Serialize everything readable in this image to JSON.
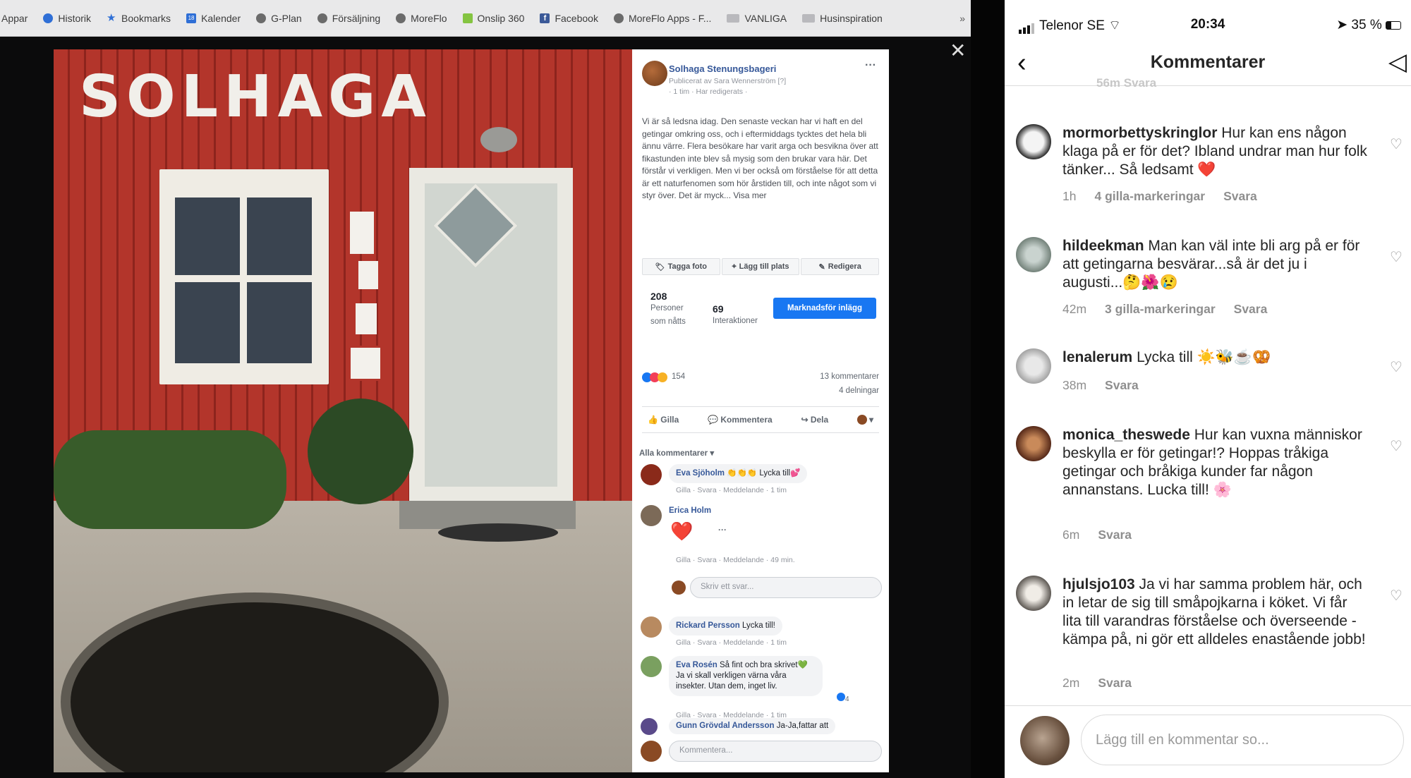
{
  "browser": {
    "bookmarks": [
      {
        "label": "Appar",
        "icon": "apps-icon"
      },
      {
        "label": "Historik",
        "icon": "history-icon"
      },
      {
        "label": "Bookmarks",
        "icon": "star-icon"
      },
      {
        "label": "Kalender",
        "icon": "calendar-icon"
      },
      {
        "label": "G-Plan",
        "icon": "globe-icon"
      },
      {
        "label": "Försäljning",
        "icon": "globe-icon"
      },
      {
        "label": "MoreFlo",
        "icon": "globe-icon"
      },
      {
        "label": "Onslip 360",
        "icon": "onslip-icon"
      },
      {
        "label": "Facebook",
        "icon": "facebook-icon"
      },
      {
        "label": "MoreFlo Apps - F...",
        "icon": "globe-icon"
      },
      {
        "label": "VANLIGA",
        "icon": "folder-icon"
      },
      {
        "label": "Husinspiration",
        "icon": "folder-icon"
      }
    ],
    "more": "»",
    "close": "✕"
  },
  "photo": {
    "sign": "SOLHAGA"
  },
  "facebook": {
    "page_name": "Solhaga Stenungsbageri",
    "published_by": "Publicerat av Sara Wennerström [?]",
    "time": "· 1 tim · Har redigerats ·",
    "post_text": "Vi är så ledsna idag. Den senaste veckan har vi haft en del getingar omkring oss, och i eftermiddags tycktes det hela bli ännu värre. Flera besökare har varit arga och besvikna över att fikastunden inte blev så mysig som den brukar vara här. Det förstår vi verkligen. Men vi ber också om förståelse för att detta är ett naturfenomen som hör årstiden till, och inte något som vi styr över. Det är myck... Visa mer",
    "actions": [
      "Tagga foto",
      "Lägg till plats",
      "Redigera"
    ],
    "reach_num": "208",
    "reach_label": "Personer som nåtts",
    "interactions_num": "69",
    "interactions_label": "Interaktioner",
    "boost": "Marknadsför inlägg",
    "reactions_count": "154",
    "comments_count": "13 kommentarer",
    "shares_count": "4 delningar",
    "like": "Gilla",
    "comment": "Kommentera",
    "share": "Dela",
    "all_comments": "Alla kommentarer ▾",
    "comments": [
      {
        "name": "Eva Sjöholm",
        "text": "👏👏👏 Lycka till💕",
        "meta": "Gilla · Svara · Meddelande · 1 tim"
      },
      {
        "name": "Erica Holm",
        "text": "❤️",
        "meta": "Gilla · Svara · Meddelande · 49 min."
      },
      {
        "name": "Rickard Persson",
        "text": "Lycka till!",
        "meta": "Gilla · Svara · Meddelande · 1 tim"
      },
      {
        "name": "Eva Rosén",
        "text": "Så fint och bra skrivet💚 Ja vi skall verkligen värna våra insekter. Utan dem, inget liv.",
        "meta": "Gilla · Svara · Meddelande · 1 tim"
      },
      {
        "name": "Gunn Grövdal Andersson",
        "text": "Ja-Ja,fattar att",
        "meta": ""
      }
    ],
    "reply_placeholder": "Skriv ett svar...",
    "comment_placeholder": "Kommentera...",
    "like_badge": "4"
  },
  "instagram": {
    "carrier": "Telenor SE",
    "time": "20:34",
    "battery": "35 %",
    "title": "Kommentarer",
    "cutoff": "56m     Svara",
    "comments": [
      {
        "user": "mormorbettyskringlor",
        "text": "Hur kan ens någon klaga på er för det? Ibland undrar man hur folk tänker... Så ledsamt ❤️",
        "time": "1h",
        "likes": "4 gilla-markeringar",
        "reply": "Svara"
      },
      {
        "user": "hildeekman",
        "text": "Man kan väl inte bli arg på er för att getingarna besvärar...så är det ju i augusti...🤔🌺😢",
        "time": "42m",
        "likes": "3 gilla-markeringar",
        "reply": "Svara"
      },
      {
        "user": "lenalerum",
        "text": "Lycka till ☀️🐝☕🥨",
        "time": "38m",
        "likes": "",
        "reply": "Svara"
      },
      {
        "user": "monica_theswede",
        "text": "Hur kan vuxna människor beskylla er för getingar!? Hoppas tråkiga getingar och bråkiga kunder far någon annanstans. Lucka till! 🌸",
        "time": "6m",
        "likes": "",
        "reply": "Svara"
      },
      {
        "user": "hjulsjo103",
        "text": "Ja vi har samma problem här, och in letar de sig till småpojkarna i köket. Vi får lita till varandras förståelse och överseende - kämpa på, ni gör ett alldeles enastående jobb!",
        "time": "2m",
        "likes": "",
        "reply": "Svara"
      }
    ],
    "input_placeholder": "Lägg till en kommentar so..."
  }
}
